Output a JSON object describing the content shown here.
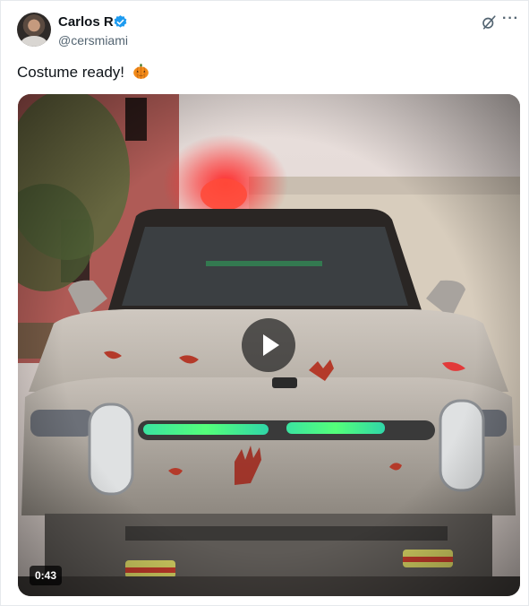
{
  "author": {
    "name": "Carlos R",
    "handle": "@cersmiami",
    "verified_color": "#1d9bf0"
  },
  "post": {
    "text": "Costume ready!",
    "emoji": "pumpkin-icon"
  },
  "media": {
    "type": "video",
    "duration": "0:43",
    "description_icons": [
      "play-icon"
    ]
  },
  "icons": {
    "grok": "grok-icon",
    "more": "more-icon",
    "more_glyph": "···"
  },
  "colors": {
    "text": "#0f1419",
    "secondary": "#536471",
    "accent": "#1d9bf0"
  }
}
